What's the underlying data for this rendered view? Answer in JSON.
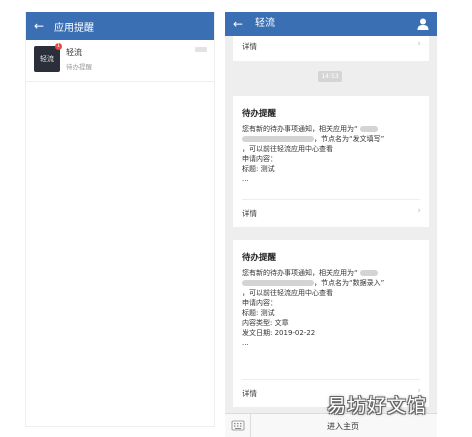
{
  "left_panel": {
    "title": "应用提醒",
    "conversation": {
      "avatar_text": "轻流",
      "name": "轻流",
      "subtitle": "待办提醒",
      "badge": "1"
    }
  },
  "right_panel": {
    "title": "轻流",
    "prev_card_detail": "详情",
    "time_chip": "14:53",
    "cards": [
      {
        "title": "待办提醒",
        "line1": "您有新的待办事项通知，相关应用为“",
        "line2_suffix": "，节点名为“发文填写”",
        "line3": "，可以前往轻流应用中心查看",
        "line4": "申请内容：",
        "line5": "标题: 测试",
        "line6": "...",
        "detail": "详情"
      },
      {
        "title": "待办提醒",
        "line1": "您有新的待办事项通知，相关应用为“",
        "line2_suffix": "，节点名为“数据录入”",
        "line3": "，可以前往轻流应用中心查看",
        "line4": "申请内容：",
        "line5": "标题: 测试",
        "line6": "内容类型: 文章",
        "line7": "发文日期: 2019-02-22",
        "line8": "...",
        "detail": "详情"
      }
    ],
    "bottom_bar": {
      "enter_label": "进入主页"
    }
  },
  "watermark": "易坊好文馆",
  "colors": {
    "header_blue": "#3b6fb3",
    "badge_red": "#e9483c",
    "chat_bg": "#eeeeee"
  }
}
